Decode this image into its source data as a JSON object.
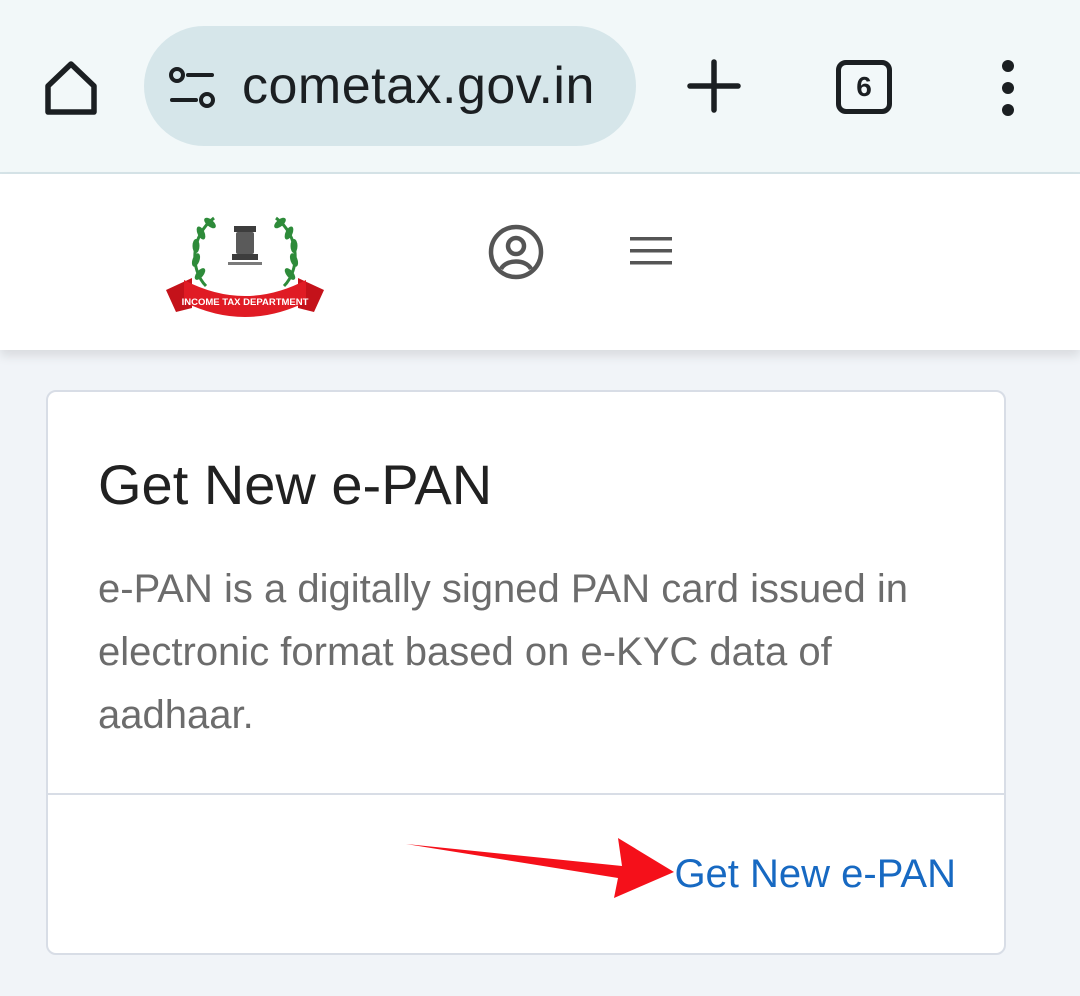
{
  "browser": {
    "url": "cometax.gov.in",
    "tab_count": "6",
    "icons": {
      "home": "home-icon",
      "site_settings": "tune-icon",
      "new_tab": "plus-icon",
      "tabs": "tab-switcher-icon",
      "menu": "more-vert-icon"
    }
  },
  "site_header": {
    "logo_text": "INCOME TAX DEPARTMENT",
    "icons": {
      "profile": "account-circle-icon",
      "menu": "hamburger-menu-icon"
    }
  },
  "card": {
    "title": "Get New e-PAN",
    "description": "e-PAN is a digitally signed PAN card issued in electronic format based on e-KYC data of aadhaar.",
    "link_label": "Get New e-PAN"
  },
  "colors": {
    "link": "#1769c2",
    "annotation_arrow": "#f5101a",
    "browser_bar": "#f2f8f9",
    "address_pill": "#d6e6ea",
    "page_background": "#f1f4f8"
  }
}
